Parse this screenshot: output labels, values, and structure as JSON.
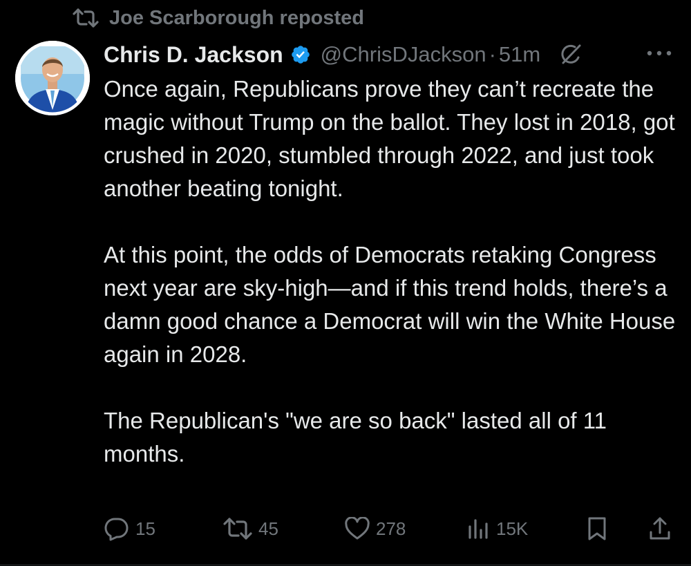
{
  "repost": {
    "label": "Joe Scarborough reposted",
    "icon": "repost-icon"
  },
  "author": {
    "name": "Chris D. Jackson",
    "handle": "@ChrisDJackson",
    "separator": "·",
    "time": "51m",
    "verified_color": "#1d9bf0",
    "avatar_icon": "avatar-photo"
  },
  "tweet": {
    "paragraphs": [
      "Once again, Republicans prove they can’t recreate the magic without Trump on the ballot. They lost in 2018, got crushed in 2020, stumbled through 2022, and just took another beating tonight.",
      "At this point, the odds of Democrats retaking Congress next year are sky-high—and if this trend holds, there’s a damn good chance a Democrat will win the White House again in 2028.",
      "The Republican's \"we are so back\" lasted all of 11 months."
    ]
  },
  "actions": {
    "replies": "15",
    "reposts": "45",
    "likes": "278",
    "views": "15K"
  },
  "colors": {
    "background": "#000000",
    "text": "#e7e9ea",
    "muted": "#71767b",
    "accent": "#1d9bf0"
  }
}
